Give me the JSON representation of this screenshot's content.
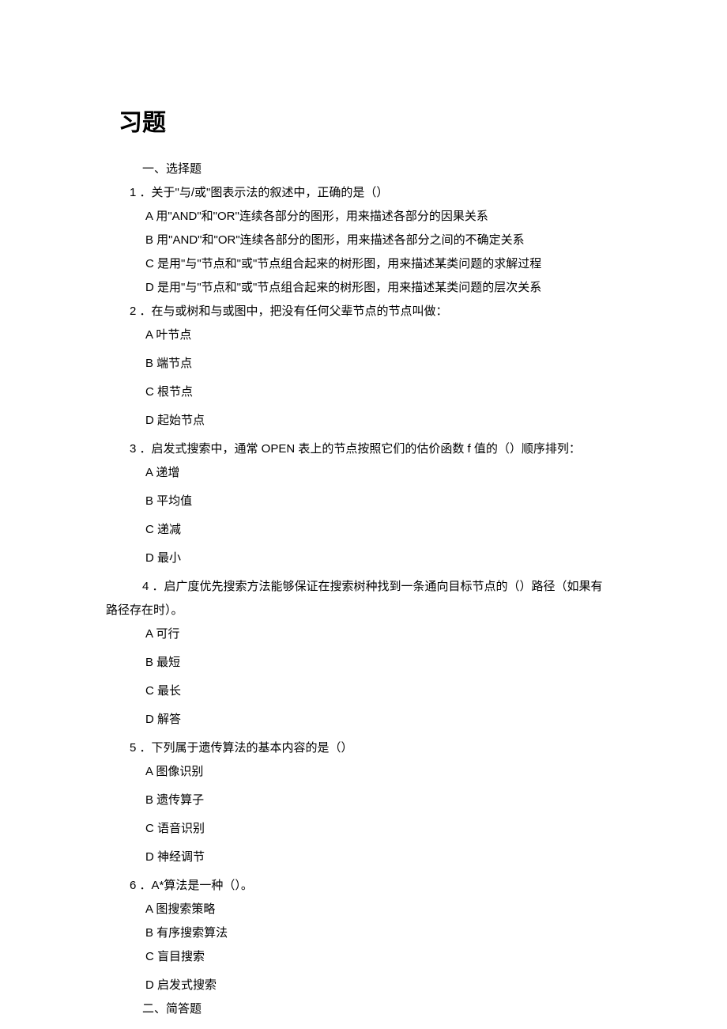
{
  "title": "习题",
  "section1": "一、选择题",
  "section2": "二、简答题",
  "questions": [
    {
      "num": "1",
      "stem": "．关于\"与/或\"图表示法的叙述中，正确的是（）",
      "options": [
        "A 用\"AND\"和\"OR\"连续各部分的图形，用来描述各部分的因果关系",
        "B 用\"AND\"和\"OR\"连续各部分的图形，用来描述各部分之间的不确定关系",
        "C 是用\"与\"节点和\"或\"节点组合起来的树形图，用来描述某类问题的求解过程",
        "D 是用\"与\"节点和\"或\"节点组合起来的树形图，用来描述某类问题的层次关系"
      ]
    },
    {
      "num": "2",
      "stem": "．在与或树和与或图中，把没有任何父辈节点的节点叫做：",
      "options": [
        "A 叶节点",
        "B 端节点",
        "C 根节点",
        "D 起始节点"
      ]
    },
    {
      "num": "3",
      "stem": "．启发式搜索中，通常 OPEN 表上的节点按照它们的估价函数 f 值的（）顺序排列：",
      "options": [
        "A 递增",
        "B 平均值",
        "C 递减",
        "D 最小"
      ]
    },
    {
      "num": "4",
      "stem_line1": "．启广度优先搜索方法能够保证在搜索树种找到一条通向目标节点的（）路径（如果有",
      "stem_line2": "路径存在时）。",
      "options": [
        "A 可行",
        "B 最短",
        "C 最长",
        "D 解答"
      ]
    },
    {
      "num": "5",
      "stem": "．下列属于遗传算法的基本内容的是（）",
      "options": [
        "A 图像识别",
        "B 遗传算子",
        "C 语音识别",
        "D 神经调节"
      ]
    },
    {
      "num": "6",
      "stem": "．A*算法是一种（）。",
      "options": [
        "A 图搜索策略",
        "B 有序搜索算法",
        "C 盲目搜索",
        "D 启发式搜索"
      ]
    }
  ]
}
